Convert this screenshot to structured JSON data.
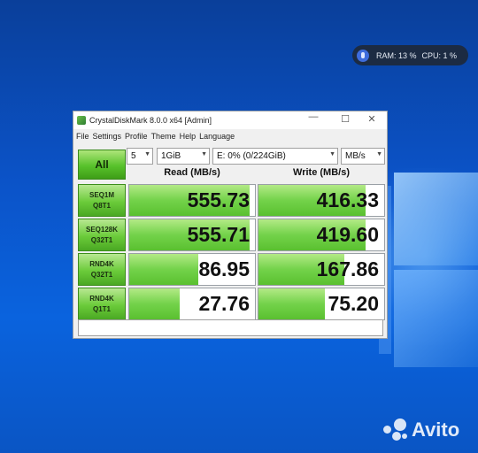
{
  "widget": {
    "ram": "RAM: 13 %",
    "cpu": "CPU: 1 %",
    "icon": "microphone-icon"
  },
  "window": {
    "title": "CrystalDiskMark 8.0.0 x64 [Admin]",
    "controls": {
      "minimize": "—",
      "maximize": "☐",
      "close": "✕"
    },
    "menu": [
      "File",
      "Settings",
      "Profile",
      "Theme",
      "Help",
      "Language"
    ]
  },
  "toolbar": {
    "all_label": "All",
    "count": "5",
    "size": "1GiB",
    "drive": "E: 0% (0/224GiB)",
    "unit": "MB/s"
  },
  "headers": {
    "read": "Read (MB/s)",
    "write": "Write (MB/s)"
  },
  "rows": [
    {
      "l1": "SEQ1M",
      "l2": "Q8T1",
      "read": "555.73",
      "write": "416.33",
      "read_fill": 0.96,
      "write_fill": 0.85
    },
    {
      "l1": "SEQ128K",
      "l2": "Q32T1",
      "read": "555.71",
      "write": "419.60",
      "read_fill": 0.96,
      "write_fill": 0.85
    },
    {
      "l1": "RND4K",
      "l2": "Q32T1",
      "read": "86.95",
      "write": "167.86",
      "read_fill": 0.55,
      "write_fill": 0.68
    },
    {
      "l1": "RND4K",
      "l2": "Q1T1",
      "read": "27.76",
      "write": "75.20",
      "read_fill": 0.4,
      "write_fill": 0.53
    }
  ],
  "colors": {
    "accent_green": "#5ac030",
    "desktop_blue": "#0b53c8"
  },
  "watermark": {
    "text": "Avito"
  }
}
